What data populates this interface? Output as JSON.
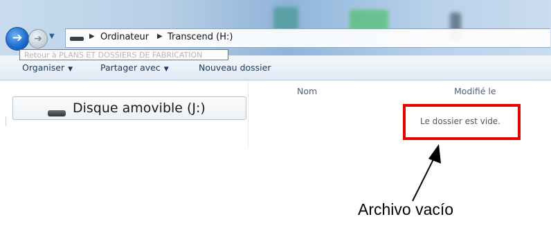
{
  "window": {
    "address_bar": {
      "crumbs": [
        "Ordinateur",
        "Transcend (H:)"
      ],
      "drive_icon": "removable-drive-icon"
    },
    "back_tooltip": "Retour à PLANS ET DOSSIERS DE FABRICATION",
    "nav_buttons": {
      "back_icon": "back-arrow-icon",
      "forward_icon": "forward-arrow-icon",
      "history_icon": "chevron-down-icon"
    }
  },
  "toolbar": {
    "organise_label": "Organiser",
    "share_label": "Partager avec",
    "new_folder_label": "Nouveau dossier"
  },
  "nav_pane": {
    "items": [
      {
        "label": "Disque amovible (J:)",
        "icon": "removable-drive-icon"
      }
    ]
  },
  "content": {
    "columns": [
      "Nom",
      "Modifié le"
    ],
    "empty_message": "Le dossier est vide."
  },
  "annotation": {
    "label": "Archivo vacío",
    "color": "#e60000"
  }
}
